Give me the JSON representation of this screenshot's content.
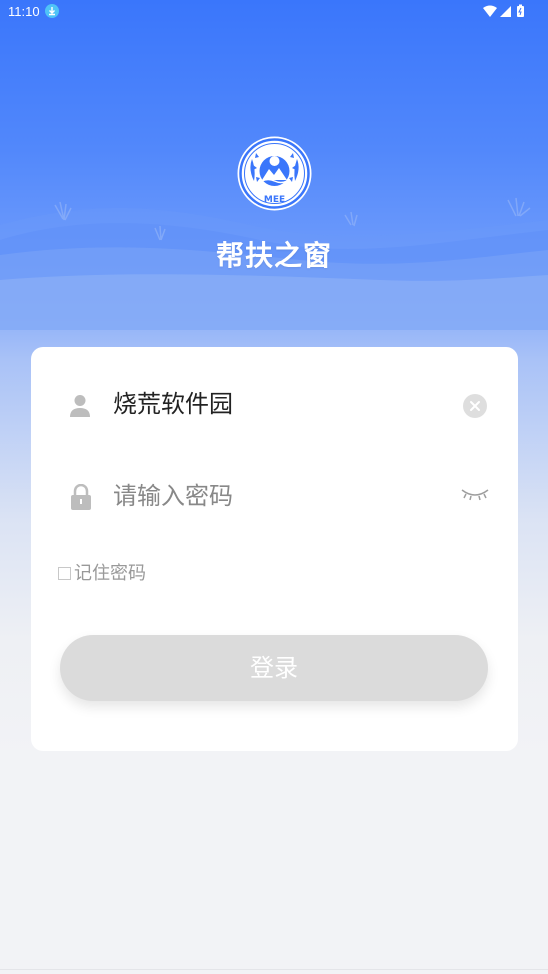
{
  "status_bar": {
    "time": "11:10",
    "icons": [
      "download-icon",
      "wifi-icon",
      "signal-icon",
      "battery-icon"
    ]
  },
  "app": {
    "logo_text": "MEE",
    "title": "帮扶之窗"
  },
  "login_form": {
    "username_value": "烧荒软件园",
    "password_placeholder": "请输入密码",
    "remember_label": "记住密码",
    "remember_checked": false,
    "login_label": "登录"
  },
  "colors": {
    "primary_blue": "#3a76fb",
    "button_disabled": "#dbdbdb",
    "icon_gray": "#bdbdbd",
    "placeholder": "#888888"
  }
}
